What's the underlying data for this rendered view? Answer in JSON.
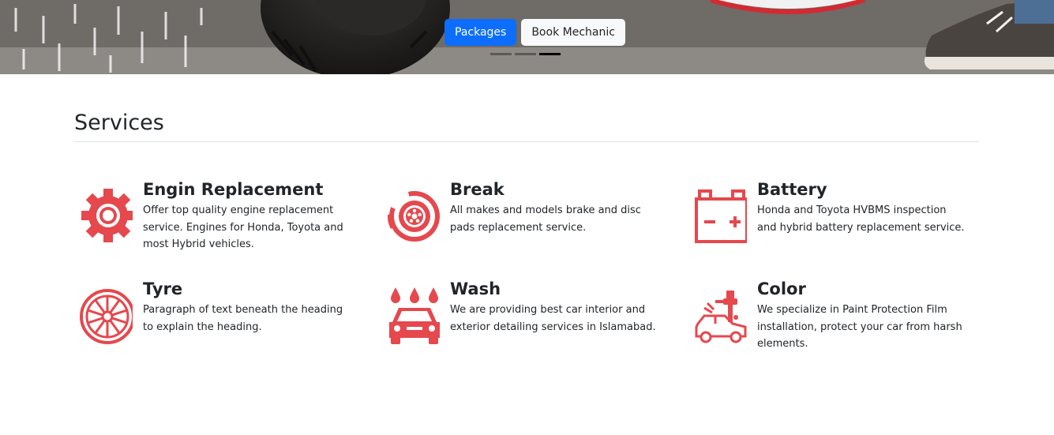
{
  "hero": {
    "packages_label": "Packages",
    "book_mechanic_label": "Book Mechanic",
    "slides": [
      {
        "active": false
      },
      {
        "active": false
      },
      {
        "active": true
      }
    ]
  },
  "services": {
    "title": "Services",
    "items": [
      {
        "name": "Engin Replacement",
        "icon": "gear-icon",
        "description": "Offer top quality engine replacement service. Engines for Honda, Toyota and most Hybrid vehicles."
      },
      {
        "name": "Break",
        "icon": "brake-disc-icon",
        "description": "All makes and models brake and disc pads replacement service."
      },
      {
        "name": "Battery",
        "icon": "battery-icon",
        "description": "Honda and Toyota HVBMS inspection and hybrid battery replacement service."
      },
      {
        "name": "Tyre",
        "icon": "wheel-icon",
        "description": "Paragraph of text beneath the heading to explain the heading."
      },
      {
        "name": "Wash",
        "icon": "car-wash-icon",
        "description": "We are providing best car interior and exterior detailing services in Islamabad."
      },
      {
        "name": "Color",
        "icon": "paint-spray-car-icon",
        "description": "We specialize in Paint Protection Film installation, protect your car from harsh elements."
      }
    ]
  },
  "colors": {
    "accent_red": "#e5484d",
    "primary_blue": "#0d6efd"
  }
}
